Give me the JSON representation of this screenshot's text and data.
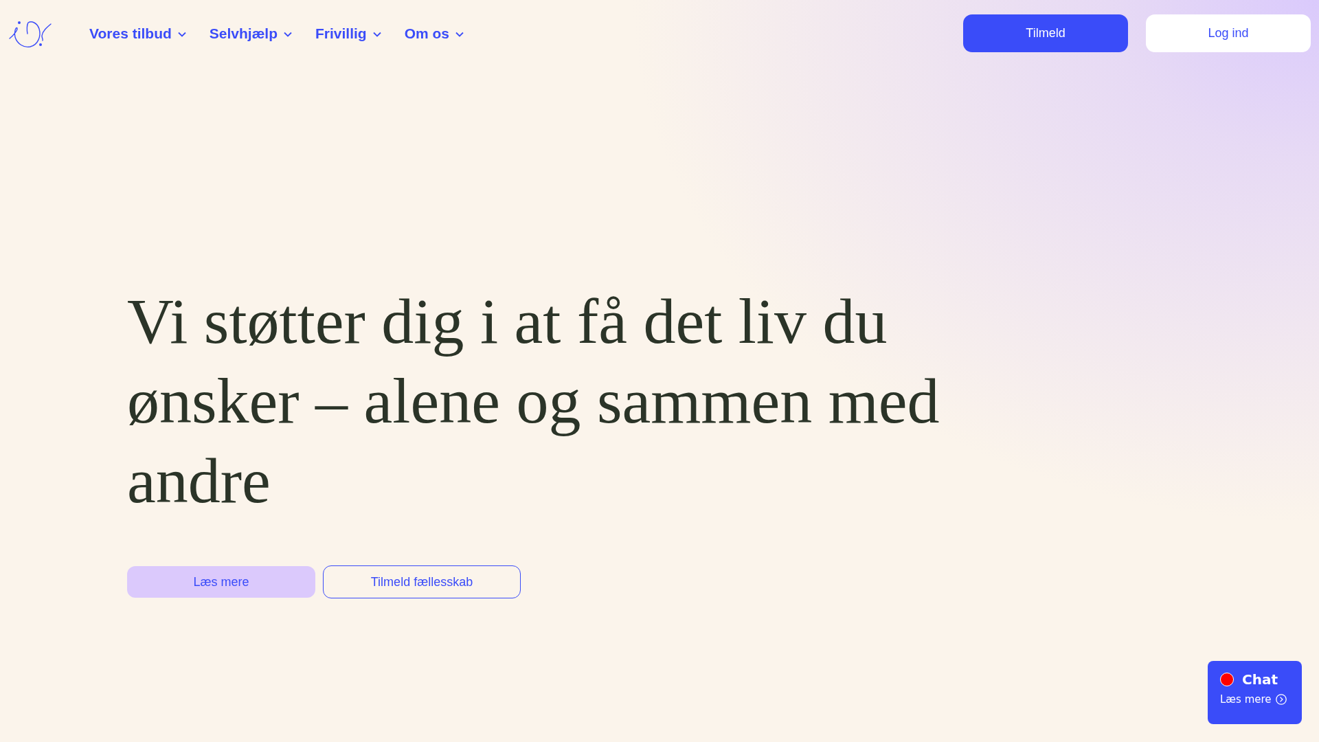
{
  "nav": {
    "items": [
      {
        "label": "Vores tilbud"
      },
      {
        "label": "Selvhjælp"
      },
      {
        "label": "Frivillig"
      },
      {
        "label": "Om os"
      }
    ]
  },
  "header_buttons": [
    {
      "label": "Tilmeld",
      "kind": "primary"
    },
    {
      "label": "Log ind",
      "kind": "secondary"
    }
  ],
  "hero": {
    "heading": "Vi støtter dig i at få det liv du ønsker – alene og sammen med andre",
    "buttons": [
      {
        "label": "Læs mere",
        "kind": "filled"
      },
      {
        "label": "Tilmeld fællesskab",
        "kind": "outline"
      }
    ]
  },
  "chat_widget": {
    "title": "Chat",
    "link": "Læs mere"
  }
}
